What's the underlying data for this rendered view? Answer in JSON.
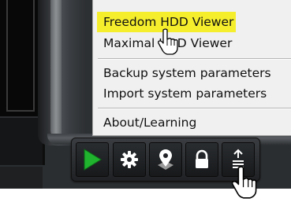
{
  "menu": {
    "items": [
      {
        "label": "Freedom HDD Viewer",
        "highlighted": true
      },
      {
        "label": "Maximal HDD Viewer",
        "highlighted": false
      },
      {
        "label": "Backup system parameters",
        "highlighted": false
      },
      {
        "label": "Import system parameters",
        "highlighted": false
      },
      {
        "label": "About/Learning",
        "highlighted": false
      }
    ],
    "highlight_color": "#f5ee2d"
  },
  "toolbar": {
    "buttons": [
      {
        "icon": "play-icon",
        "color": "#1fb32e"
      },
      {
        "icon": "gear-icon",
        "color": "#ffffff"
      },
      {
        "icon": "map-pin-icon",
        "color": "#ffffff"
      },
      {
        "icon": "lock-icon",
        "color": "#ffffff"
      },
      {
        "icon": "upload-menu-icon",
        "color": "#ffffff"
      }
    ]
  },
  "cursor": {
    "icon": "hand-pointer-icon"
  }
}
